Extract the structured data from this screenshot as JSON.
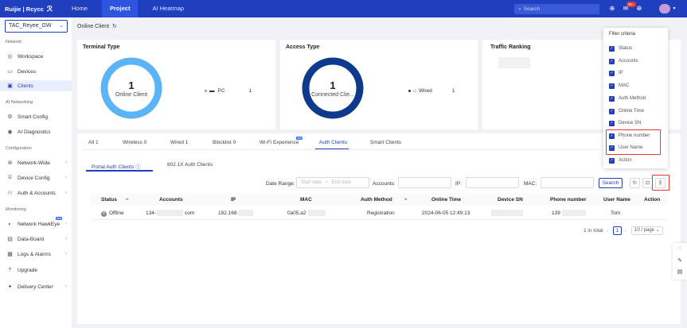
{
  "brand": {
    "name": "Ruijie | Rcycc"
  },
  "nav": {
    "home": "Home",
    "project": "Project",
    "ai_heatmap": "AI Heatmap"
  },
  "search": {
    "placeholder": "Search"
  },
  "notifications": {
    "badge": "99+"
  },
  "sidebar": {
    "site": "TAC_Reyee_GW",
    "sections": {
      "network": "Network",
      "ai_networking": "AI Networking",
      "configuration": "Configuration",
      "monitoring": "Monitoring"
    },
    "items": {
      "workspace": "Workspace",
      "devices": "Devices",
      "clients": "Clients",
      "smart_config": "Smart Config",
      "ai_diagnostics": "AI Diagnostics",
      "network_wide": "Network-Wide",
      "device_config": "Device Config",
      "auth_accounts": "Auth & Accounts",
      "network_hawkeye": "Network HawkEye",
      "data_board": "Data-Board",
      "logs_alarms": "Logs & Alarms",
      "upgrade": "Upgrade",
      "delivery_center": "Delivery Center"
    },
    "new_tag": "new"
  },
  "page": {
    "title": "Online Client"
  },
  "terminal_type": {
    "title": "Terminal Type",
    "count": "1",
    "label": "Online Client",
    "legend_name": "PC",
    "legend_value": "1",
    "color": "#5bb4f5"
  },
  "access_type": {
    "title": "Access Type",
    "count": "1",
    "label": "Connected Clie...",
    "legend_name": "Wired",
    "legend_value": "1",
    "color": "#0d3a8c"
  },
  "traffic_ranking": {
    "title": "Traffic Ranking"
  },
  "tabs": {
    "all": "All",
    "all_count": "1",
    "wireless": "Wireless",
    "wireless_count": "0",
    "wired": "Wired",
    "wired_count": "1",
    "blocklist": "Blocklist",
    "blocklist_count": "0",
    "wifi_experience": "Wi-Fi Experience",
    "wifi_tag": "new",
    "auth_clients": "Auth Clients",
    "smart_clients": "Smart Clients"
  },
  "subtabs": {
    "portal": "Portal Auth Clients",
    "dot1x": "802.1X Auth Clients"
  },
  "filters": {
    "date_range_label": "Date Range:",
    "start_placeholder": "Start date",
    "separator": "~",
    "end_placeholder": "End date",
    "accounts_label": "Accounts:",
    "ip_label": "IP:",
    "mac_label": "MAC:",
    "search_button": "Search"
  },
  "table": {
    "headers": {
      "status": "Status",
      "accounts": "Accounts",
      "ip": "IP",
      "mac": "MAC",
      "auth_method": "Auth Method",
      "online_time": "Online Time",
      "device_sn": "Device SN",
      "phone": "Phone number",
      "user_name": "User Name",
      "action": "Action"
    },
    "rows": [
      {
        "status": "Offline",
        "account_prefix": "134-",
        "account_suffix": "com",
        "ip": "192.168.",
        "mac": "0a05.a2",
        "auth_method": "Registration",
        "online_time": "2024-06-05 12:49:13",
        "phone": "139",
        "user_name": "Tom"
      }
    ]
  },
  "pagination": {
    "total": "1 in total",
    "page": "1",
    "page_size": "10 / page"
  },
  "filter_criteria": {
    "title": "Filter criteria",
    "items": [
      "Status",
      "Accounts",
      "IP",
      "MAC",
      "Auth Method",
      "Online Time",
      "Device SN",
      "Phone number",
      "User Name",
      "Action"
    ]
  }
}
